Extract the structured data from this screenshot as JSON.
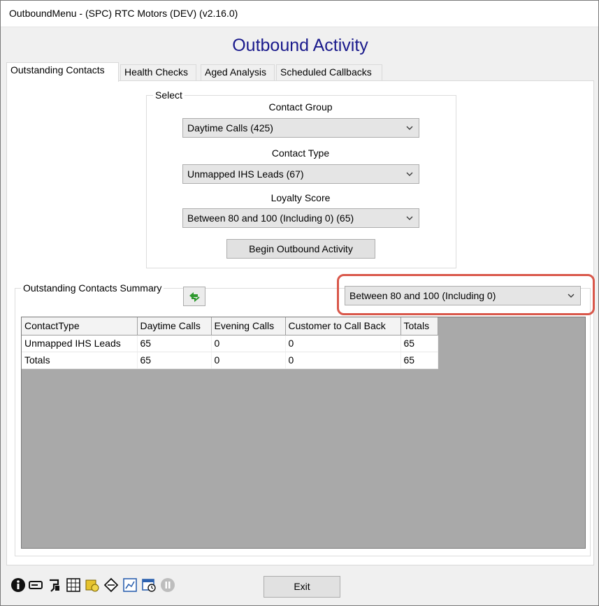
{
  "window": {
    "title": "OutboundMenu - (SPC) RTC Motors (DEV) (v2.16.0)"
  },
  "heading": "Outbound Activity",
  "tabs": [
    {
      "label": "Outstanding Contacts",
      "active": true
    },
    {
      "label": "Health Checks"
    },
    {
      "label": "Aged Analysis"
    },
    {
      "label": "Scheduled Callbacks"
    }
  ],
  "select_group": {
    "legend": "Select",
    "contact_group_label": "Contact Group",
    "contact_group_value": "Daytime Calls (425)",
    "contact_type_label": "Contact Type",
    "contact_type_value": "Unmapped IHS Leads (67)",
    "loyalty_label": "Loyalty Score",
    "loyalty_value": "Between 80 and 100 (Including 0) (65)",
    "begin_button": "Begin Outbound Activity"
  },
  "summary": {
    "legend": "Outstanding Contacts Summary",
    "refresh_icon": "refresh-icon",
    "filter_value": "Between 80 and 100 (Including 0)",
    "highlight_color": "#d9574a"
  },
  "table": {
    "columns": [
      "ContactType",
      "Daytime Calls",
      "Evening Calls",
      "Customer to Call Back",
      "Totals"
    ],
    "rows": [
      [
        "Unmapped IHS Leads",
        "65",
        "0",
        "0",
        "65"
      ],
      [
        "Totals",
        "65",
        "0",
        "0",
        "65"
      ]
    ]
  },
  "footer": {
    "exit_button": "Exit",
    "icons": [
      "info-icon",
      "keycard-icon",
      "cable-plug-icon",
      "grid-table-icon",
      "money-icon",
      "tools-diamond-icon",
      "chart-report-icon",
      "calendar-clock-icon",
      "pause-disabled-icon"
    ]
  },
  "colors": {
    "heading": "#1a1a8c",
    "grid_background": "#a9a9a9"
  }
}
